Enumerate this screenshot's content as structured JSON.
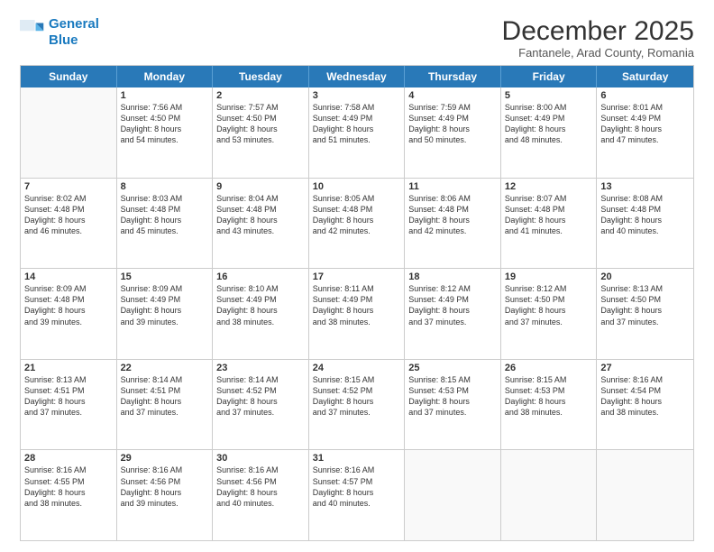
{
  "logo": {
    "line1": "General",
    "line2": "Blue"
  },
  "title": "December 2025",
  "subtitle": "Fantanele, Arad County, Romania",
  "header_days": [
    "Sunday",
    "Monday",
    "Tuesday",
    "Wednesday",
    "Thursday",
    "Friday",
    "Saturday"
  ],
  "rows": [
    [
      {
        "day": "",
        "lines": []
      },
      {
        "day": "1",
        "lines": [
          "Sunrise: 7:56 AM",
          "Sunset: 4:50 PM",
          "Daylight: 8 hours",
          "and 54 minutes."
        ]
      },
      {
        "day": "2",
        "lines": [
          "Sunrise: 7:57 AM",
          "Sunset: 4:50 PM",
          "Daylight: 8 hours",
          "and 53 minutes."
        ]
      },
      {
        "day": "3",
        "lines": [
          "Sunrise: 7:58 AM",
          "Sunset: 4:49 PM",
          "Daylight: 8 hours",
          "and 51 minutes."
        ]
      },
      {
        "day": "4",
        "lines": [
          "Sunrise: 7:59 AM",
          "Sunset: 4:49 PM",
          "Daylight: 8 hours",
          "and 50 minutes."
        ]
      },
      {
        "day": "5",
        "lines": [
          "Sunrise: 8:00 AM",
          "Sunset: 4:49 PM",
          "Daylight: 8 hours",
          "and 48 minutes."
        ]
      },
      {
        "day": "6",
        "lines": [
          "Sunrise: 8:01 AM",
          "Sunset: 4:49 PM",
          "Daylight: 8 hours",
          "and 47 minutes."
        ]
      }
    ],
    [
      {
        "day": "7",
        "lines": [
          "Sunrise: 8:02 AM",
          "Sunset: 4:48 PM",
          "Daylight: 8 hours",
          "and 46 minutes."
        ]
      },
      {
        "day": "8",
        "lines": [
          "Sunrise: 8:03 AM",
          "Sunset: 4:48 PM",
          "Daylight: 8 hours",
          "and 45 minutes."
        ]
      },
      {
        "day": "9",
        "lines": [
          "Sunrise: 8:04 AM",
          "Sunset: 4:48 PM",
          "Daylight: 8 hours",
          "and 43 minutes."
        ]
      },
      {
        "day": "10",
        "lines": [
          "Sunrise: 8:05 AM",
          "Sunset: 4:48 PM",
          "Daylight: 8 hours",
          "and 42 minutes."
        ]
      },
      {
        "day": "11",
        "lines": [
          "Sunrise: 8:06 AM",
          "Sunset: 4:48 PM",
          "Daylight: 8 hours",
          "and 42 minutes."
        ]
      },
      {
        "day": "12",
        "lines": [
          "Sunrise: 8:07 AM",
          "Sunset: 4:48 PM",
          "Daylight: 8 hours",
          "and 41 minutes."
        ]
      },
      {
        "day": "13",
        "lines": [
          "Sunrise: 8:08 AM",
          "Sunset: 4:48 PM",
          "Daylight: 8 hours",
          "and 40 minutes."
        ]
      }
    ],
    [
      {
        "day": "14",
        "lines": [
          "Sunrise: 8:09 AM",
          "Sunset: 4:48 PM",
          "Daylight: 8 hours",
          "and 39 minutes."
        ]
      },
      {
        "day": "15",
        "lines": [
          "Sunrise: 8:09 AM",
          "Sunset: 4:49 PM",
          "Daylight: 8 hours",
          "and 39 minutes."
        ]
      },
      {
        "day": "16",
        "lines": [
          "Sunrise: 8:10 AM",
          "Sunset: 4:49 PM",
          "Daylight: 8 hours",
          "and 38 minutes."
        ]
      },
      {
        "day": "17",
        "lines": [
          "Sunrise: 8:11 AM",
          "Sunset: 4:49 PM",
          "Daylight: 8 hours",
          "and 38 minutes."
        ]
      },
      {
        "day": "18",
        "lines": [
          "Sunrise: 8:12 AM",
          "Sunset: 4:49 PM",
          "Daylight: 8 hours",
          "and 37 minutes."
        ]
      },
      {
        "day": "19",
        "lines": [
          "Sunrise: 8:12 AM",
          "Sunset: 4:50 PM",
          "Daylight: 8 hours",
          "and 37 minutes."
        ]
      },
      {
        "day": "20",
        "lines": [
          "Sunrise: 8:13 AM",
          "Sunset: 4:50 PM",
          "Daylight: 8 hours",
          "and 37 minutes."
        ]
      }
    ],
    [
      {
        "day": "21",
        "lines": [
          "Sunrise: 8:13 AM",
          "Sunset: 4:51 PM",
          "Daylight: 8 hours",
          "and 37 minutes."
        ]
      },
      {
        "day": "22",
        "lines": [
          "Sunrise: 8:14 AM",
          "Sunset: 4:51 PM",
          "Daylight: 8 hours",
          "and 37 minutes."
        ]
      },
      {
        "day": "23",
        "lines": [
          "Sunrise: 8:14 AM",
          "Sunset: 4:52 PM",
          "Daylight: 8 hours",
          "and 37 minutes."
        ]
      },
      {
        "day": "24",
        "lines": [
          "Sunrise: 8:15 AM",
          "Sunset: 4:52 PM",
          "Daylight: 8 hours",
          "and 37 minutes."
        ]
      },
      {
        "day": "25",
        "lines": [
          "Sunrise: 8:15 AM",
          "Sunset: 4:53 PM",
          "Daylight: 8 hours",
          "and 37 minutes."
        ]
      },
      {
        "day": "26",
        "lines": [
          "Sunrise: 8:15 AM",
          "Sunset: 4:53 PM",
          "Daylight: 8 hours",
          "and 38 minutes."
        ]
      },
      {
        "day": "27",
        "lines": [
          "Sunrise: 8:16 AM",
          "Sunset: 4:54 PM",
          "Daylight: 8 hours",
          "and 38 minutes."
        ]
      }
    ],
    [
      {
        "day": "28",
        "lines": [
          "Sunrise: 8:16 AM",
          "Sunset: 4:55 PM",
          "Daylight: 8 hours",
          "and 38 minutes."
        ]
      },
      {
        "day": "29",
        "lines": [
          "Sunrise: 8:16 AM",
          "Sunset: 4:56 PM",
          "Daylight: 8 hours",
          "and 39 minutes."
        ]
      },
      {
        "day": "30",
        "lines": [
          "Sunrise: 8:16 AM",
          "Sunset: 4:56 PM",
          "Daylight: 8 hours",
          "and 40 minutes."
        ]
      },
      {
        "day": "31",
        "lines": [
          "Sunrise: 8:16 AM",
          "Sunset: 4:57 PM",
          "Daylight: 8 hours",
          "and 40 minutes."
        ]
      },
      {
        "day": "",
        "lines": []
      },
      {
        "day": "",
        "lines": []
      },
      {
        "day": "",
        "lines": []
      }
    ]
  ]
}
